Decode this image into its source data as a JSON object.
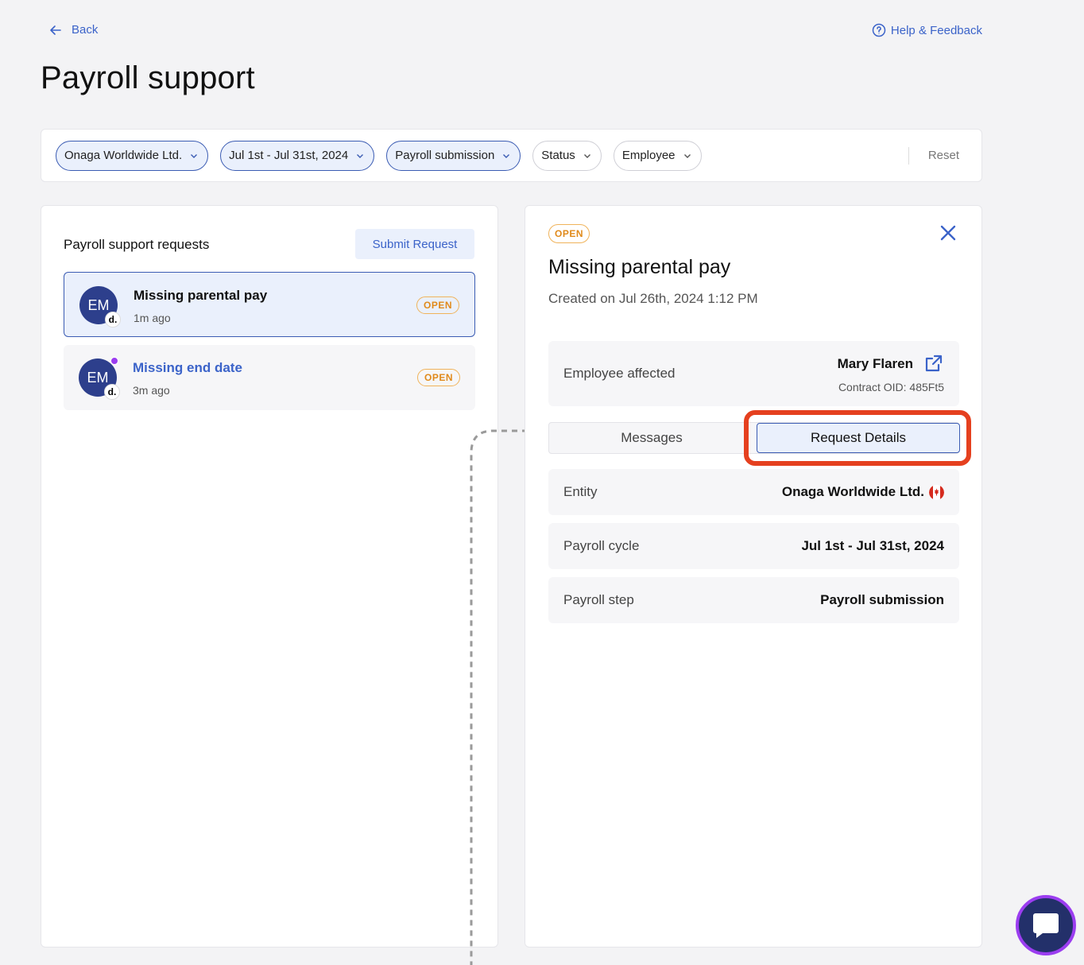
{
  "nav": {
    "back_label": "Back",
    "help_label": "Help & Feedback"
  },
  "page": {
    "title": "Payroll support"
  },
  "filters": {
    "chips": [
      {
        "label": "Onaga Worldwide Ltd.",
        "active": true
      },
      {
        "label": "Jul 1st - Jul 31st, 2024",
        "active": true
      },
      {
        "label": "Payroll submission",
        "active": true
      },
      {
        "label": "Status",
        "active": false
      },
      {
        "label": "Employee",
        "active": false
      }
    ],
    "reset_label": "Reset"
  },
  "requests": {
    "title": "Payroll support requests",
    "submit_label": "Submit Request",
    "items": [
      {
        "initials": "EM",
        "badge": "d.",
        "title": "Missing parental pay",
        "time": "1m ago",
        "status": "OPEN",
        "selected": true,
        "unread": false
      },
      {
        "initials": "EM",
        "badge": "d.",
        "title": "Missing end date",
        "time": "3m ago",
        "status": "OPEN",
        "selected": false,
        "unread": true
      }
    ]
  },
  "detail": {
    "status": "OPEN",
    "title": "Missing parental pay",
    "created": "Created on Jul 26th, 2024 1:12 PM",
    "employee": {
      "label": "Employee affected",
      "name": "Mary Flaren",
      "oid": "Contract OID: 485Ft5"
    },
    "tabs": {
      "messages": "Messages",
      "request_details": "Request Details",
      "active": "request_details"
    },
    "rows": [
      {
        "label": "Entity",
        "value": "Onaga Worldwide Ltd.",
        "flag": "canada-flag-icon"
      },
      {
        "label": "Payroll cycle",
        "value": "Jul 1st - Jul 31st, 2024"
      },
      {
        "label": "Payroll step",
        "value": "Payroll submission"
      }
    ]
  },
  "colors": {
    "accent": "#3b63c9",
    "selected_border": "#3b5cb3",
    "selected_bg": "#eaf0fc",
    "open_badge": "#e08a1b",
    "highlight": "#e5401f",
    "avatar": "#2d3f8c",
    "unread_dot": "#9b3df0"
  }
}
